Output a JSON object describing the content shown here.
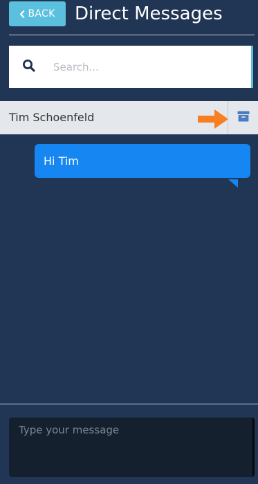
{
  "header": {
    "back_label": "BACK",
    "title": "Direct Messages"
  },
  "search": {
    "placeholder": "Search...",
    "icon": "search-icon"
  },
  "conversation": {
    "name": "Tim Schoenfeld",
    "archive_icon": "archive-icon",
    "pointer_icon": "arrow-right-icon"
  },
  "messages": [
    {
      "text": "Hi Tim"
    }
  ],
  "composer": {
    "placeholder": "Type your message"
  },
  "colors": {
    "background": "#213554",
    "back_button": "#5bc0de",
    "bubble": "#1686f3",
    "arrow": "#f77f22",
    "archive": "#4a7dc0"
  }
}
